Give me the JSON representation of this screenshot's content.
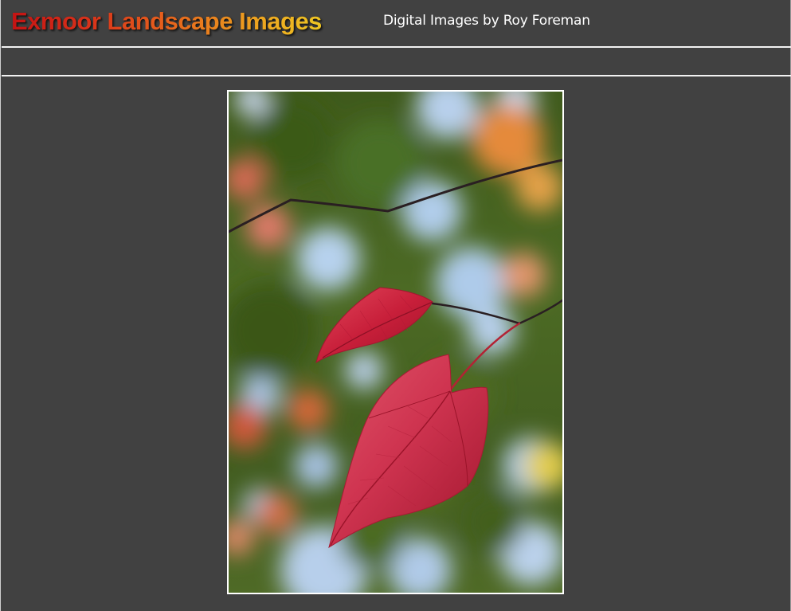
{
  "header": {
    "site_title": "Exmoor Landscape Images",
    "tagline": "Digital Images by Roy Foreman"
  },
  "nav": {
    "items": []
  },
  "main": {
    "photo": {
      "icon": "photo-red-autumn-leaves",
      "subject_colors": {
        "leaf": "#c8203a",
        "background_foliage": "#4a6b26",
        "sky": "#b9d3ee",
        "branch": "#2a1f22"
      }
    }
  },
  "theme": {
    "background": "#414141",
    "rule_color": "#f2f2f2",
    "title_gradient": [
      "#c41313",
      "#e6611c",
      "#efc623"
    ],
    "text_color": "#ffffff"
  }
}
